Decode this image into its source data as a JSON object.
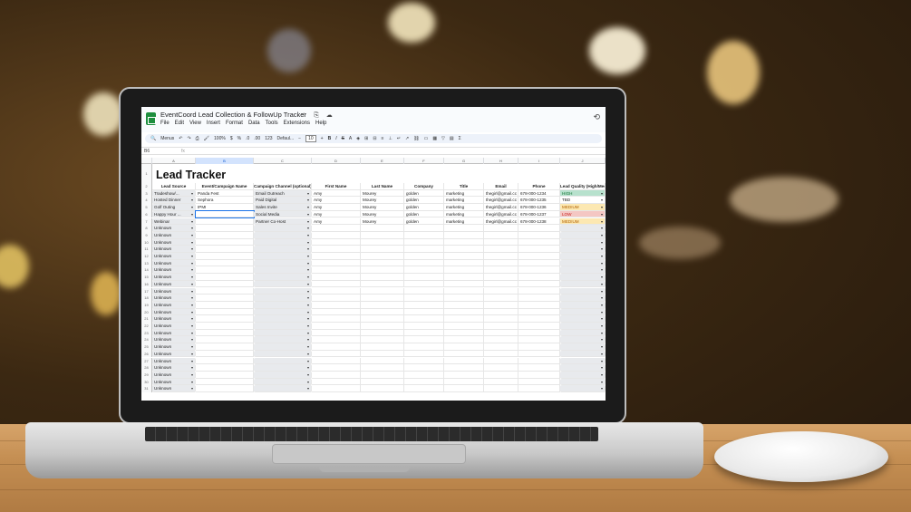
{
  "window": {
    "doc_title": "EventCoord Lead Collection & FollowUp Tracker",
    "menus": [
      "File",
      "Edit",
      "View",
      "Insert",
      "Format",
      "Data",
      "Tools",
      "Extensions",
      "Help"
    ]
  },
  "toolbar": {
    "menus_label": "Menus",
    "zoom": "100%",
    "currency": "$",
    "percent": "%",
    "number_format": "123",
    "font": "Defaul...",
    "font_size": "10"
  },
  "formula_bar": {
    "cell_ref": "B6",
    "fx": "fx"
  },
  "columns": [
    "A",
    "B",
    "C",
    "D",
    "E",
    "F",
    "G",
    "H",
    "I",
    "J"
  ],
  "selected_column": "B",
  "sheet_title": "Lead Tracker",
  "headers": [
    "Lead Source",
    "Event/Campaign Name",
    "Campaign Channel (optional)",
    "First Name",
    "Last Name",
    "Company",
    "Title",
    "Email",
    "Phone",
    "Lead Quality (High/Med/Low)"
  ],
  "rows": [
    {
      "num": "3",
      "source": "Tradeshow/...",
      "event": "Panda Fest",
      "channel": "Email Outreach",
      "first": "Amy",
      "last": "Mourey",
      "company": "golden",
      "title": "marketing",
      "email": "thegirl@gmail.cc",
      "phone": "678-000-1234",
      "quality": "HIGH"
    },
    {
      "num": "4",
      "source": "Hosted Dinner",
      "event": "Sephora",
      "channel": "Paid Digital",
      "first": "Amy",
      "last": "Mourey",
      "company": "golden",
      "title": "marketing",
      "email": "thegirl@gmail.cc",
      "phone": "678-000-1235",
      "quality": "TBD"
    },
    {
      "num": "5",
      "source": "Golf Outing",
      "event": "IPMI",
      "channel": "Sales Invite",
      "first": "Amy",
      "last": "Mourey",
      "company": "golden",
      "title": "marketing",
      "email": "thegirl@gmail.cc",
      "phone": "678-000-1236",
      "quality": "MEDIUM"
    },
    {
      "num": "6",
      "source": "Happy Hour ...",
      "event": "",
      "channel": "Social Media",
      "first": "Amy",
      "last": "Mourey",
      "company": "golden",
      "title": "marketing",
      "email": "thegirl@gmail.cc",
      "phone": "678-000-1237",
      "quality": "LOW"
    },
    {
      "num": "7",
      "source": "Webinar",
      "event": "",
      "channel": "Partner Co-Host",
      "first": "Amy",
      "last": "Mourey",
      "company": "golden",
      "title": "marketing",
      "email": "thegirl@gmail.cc",
      "phone": "678-000-1238",
      "quality": "MEDIUM"
    }
  ],
  "empty_rows": [
    "8",
    "9",
    "10",
    "11",
    "12",
    "13",
    "14",
    "15",
    "16",
    "17",
    "18",
    "19",
    "20",
    "21",
    "22",
    "23",
    "24",
    "25",
    "26",
    "27",
    "28",
    "29",
    "30",
    "31"
  ],
  "default_source": "Unknown",
  "quality_colors": {
    "HIGH": "#b7e1cd",
    "TBD": "#ffffff",
    "MEDIUM": "#fce8b2",
    "LOW": "#f4c7c3"
  },
  "row_numbers_top": [
    "1",
    "2"
  ]
}
